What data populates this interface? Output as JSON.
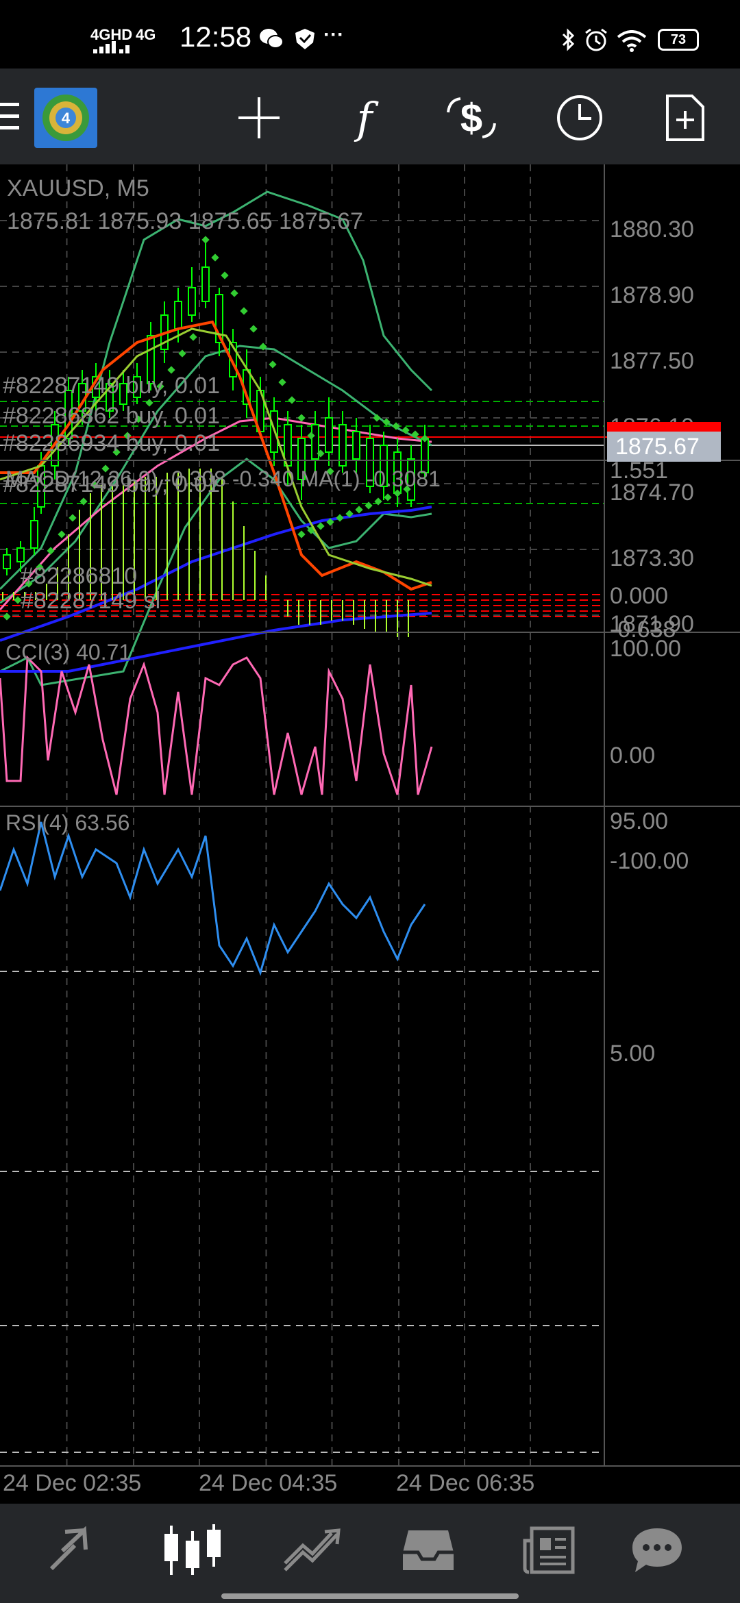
{
  "status_bar": {
    "network_1": "4GHD",
    "network_2": "4G",
    "time": "12:58",
    "more": "···",
    "battery": "73"
  },
  "toolbar": {
    "icons": [
      "app-logo-icon",
      "crosshair-icon",
      "indicators-icon",
      "trade-icon",
      "timeframe-icon",
      "templates-icon"
    ],
    "indicators_glyph": "f"
  },
  "chart": {
    "symbol": "XAUUSD, M5",
    "ohlc": "1875.81 1875.93 1875.65 1875.67",
    "price_axis": [
      "1880.30",
      "1878.90",
      "1877.50",
      "1876.10",
      "1874.70",
      "1873.30",
      "1871.90"
    ],
    "current_price": "1875.67",
    "orders": [
      "#82287149 buy, 0.01",
      "#82286862 buy, 0.01",
      "#82286934 buy, 0.01",
      "#82287149 buy, 0.01",
      "#82286810",
      "#82287149 sl"
    ],
    "time_axis": [
      "24 Dec 02:35",
      "24 Dec 04:35",
      "24 Dec 06:35"
    ],
    "colors": {
      "bull_candle": "#00ff00",
      "bb_line": "#3cb371",
      "ma_pink": "#ff69b4",
      "ma_blue": "#2020ff",
      "sar": "#32cd32",
      "order_line": "#00b000",
      "sl_line": "#ff0000",
      "price_tag": "#b0b8c4",
      "price_tag_red": "#ff0000"
    }
  },
  "macd": {
    "label": "MACD(12,26,9) -0.308 -0.340 MA(1) -0.3081",
    "axis": [
      "1.551",
      "0.000",
      "-0.638"
    ],
    "colors": {
      "histogram": "#adff2f",
      "macd": "#ff4500",
      "signal": "#9acd32"
    }
  },
  "cci": {
    "label": "CCI(3) 40.71",
    "axis": [
      "100.00",
      "0.00",
      "-100.00"
    ],
    "color": "#ff69b4"
  },
  "rsi": {
    "label": "RSI(4) 63.56",
    "axis": [
      "95.00",
      "5.00"
    ],
    "color": "#2e8ef0"
  },
  "bottom_nav": {
    "items": [
      "quotes-icon",
      "chart-icon",
      "trade-icon",
      "history-icon",
      "news-icon",
      "messages-icon"
    ],
    "active": "chart-icon"
  }
}
